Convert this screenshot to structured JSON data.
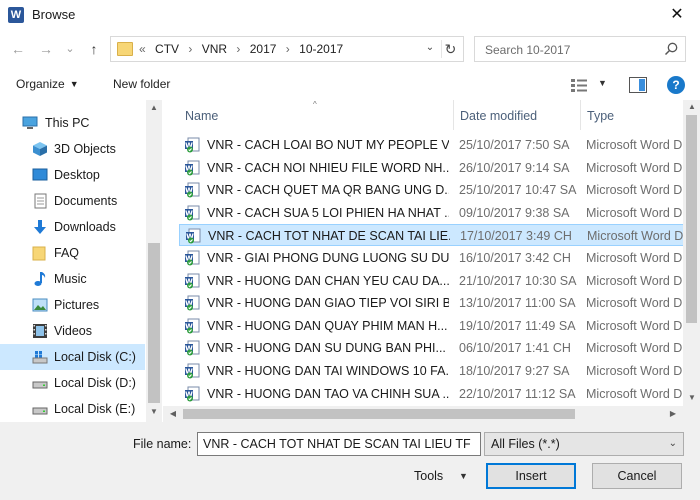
{
  "window": {
    "title": "Browse",
    "app_icon": "W",
    "close_glyph": "✕"
  },
  "nav": {
    "back_glyph": "←",
    "forward_glyph": "→",
    "recent_glyph": "⌄",
    "up_glyph": "↑",
    "path": [
      "«",
      "CTV",
      "›",
      "VNR",
      "›",
      "2017",
      "›",
      "10-2017"
    ],
    "path_dropdown_glyph": "⌄",
    "refresh_glyph": "↻",
    "search_placeholder": "Search 10-2017"
  },
  "toolbar": {
    "organize": "Organize",
    "new_folder": "New folder",
    "caret": "▼",
    "help": "?"
  },
  "sidebar": {
    "items": [
      {
        "label": "This PC",
        "icon": "pc-icon"
      },
      {
        "label": "3D Objects",
        "icon": "objects-3d-icon"
      },
      {
        "label": "Desktop",
        "icon": "desktop-icon"
      },
      {
        "label": "Documents",
        "icon": "documents-icon"
      },
      {
        "label": "Downloads",
        "icon": "download-icon"
      },
      {
        "label": "FAQ",
        "icon": "folder-icon"
      },
      {
        "label": "Music",
        "icon": "music-icon"
      },
      {
        "label": "Pictures",
        "icon": "pictures-icon"
      },
      {
        "label": "Videos",
        "icon": "videos-icon"
      },
      {
        "label": "Local Disk (C:)",
        "icon": "windows-drive-icon",
        "selected": true
      },
      {
        "label": "Local Disk (D:)",
        "icon": "drive-icon"
      },
      {
        "label": "Local Disk (E:)",
        "icon": "drive-icon"
      }
    ]
  },
  "columns": {
    "name": "Name",
    "date": "Date modified",
    "type": "Type",
    "sort_glyph": "^"
  },
  "files": [
    {
      "name": "VNR - CACH LOAI BO NUT MY PEOPLE V...",
      "date": "25/10/2017 7:50 SA",
      "type": "Microsoft Word D"
    },
    {
      "name": "VNR - CACH NOI NHIEU FILE WORD NH...",
      "date": "26/10/2017 9:14 SA",
      "type": "Microsoft Word D"
    },
    {
      "name": "VNR - CACH QUET MA QR BANG UNG D...",
      "date": "25/10/2017 10:47 SA",
      "type": "Microsoft Word D"
    },
    {
      "name": "VNR - CACH SUA 5 LOI PHIEN HA NHAT ...",
      "date": "09/10/2017 9:38 SA",
      "type": "Microsoft Word D"
    },
    {
      "name": "VNR - CACH TOT NHAT DE SCAN TAI LIE...",
      "date": "17/10/2017 3:49 CH",
      "type": "Microsoft Word D",
      "selected": true
    },
    {
      "name": "VNR - GIAI PHONG DUNG LUONG SU DU...",
      "date": "16/10/2017 3:42 CH",
      "type": "Microsoft Word D"
    },
    {
      "name": "VNR - HUONG DAN CHAN YEU CAU DA...",
      "date": "21/10/2017 10:30 SA",
      "type": "Microsoft Word D"
    },
    {
      "name": "VNR - HUONG DAN GIAO TIEP VOI SIRI B...",
      "date": "13/10/2017 11:00 SA",
      "type": "Microsoft Word D"
    },
    {
      "name": "VNR - HUONG DAN QUAY PHIM MAN H...",
      "date": "19/10/2017 11:49 SA",
      "type": "Microsoft Word D"
    },
    {
      "name": "VNR - HUONG DAN SU DUNG BAN PHI...",
      "date": "06/10/2017 1:41 CH",
      "type": "Microsoft Word D"
    },
    {
      "name": "VNR - HUONG DAN TAI WINDOWS 10 FA...",
      "date": "18/10/2017 9:27 SA",
      "type": "Microsoft Word D"
    },
    {
      "name": "VNR - HUONG DAN TAO VA CHINH SUA ...",
      "date": "22/10/2017 11:12 SA",
      "type": "Microsoft Word D"
    }
  ],
  "scroll_glyphs": {
    "up": "▲",
    "down": "▼",
    "left": "◀",
    "right": "▶"
  },
  "footer": {
    "file_name_label": "File name:",
    "file_name_value": "VNR - CACH TOT NHAT DE SCAN TAI LIEU TF",
    "filter_value": "All Files (*.*)",
    "filter_caret": "⌄",
    "tools_label": "Tools",
    "tools_caret": "▼",
    "insert_label": "Insert",
    "cancel_label": "Cancel"
  },
  "colors": {
    "selection": "#cce8ff",
    "accent": "#0078d7",
    "word_blue": "#2b579a"
  }
}
